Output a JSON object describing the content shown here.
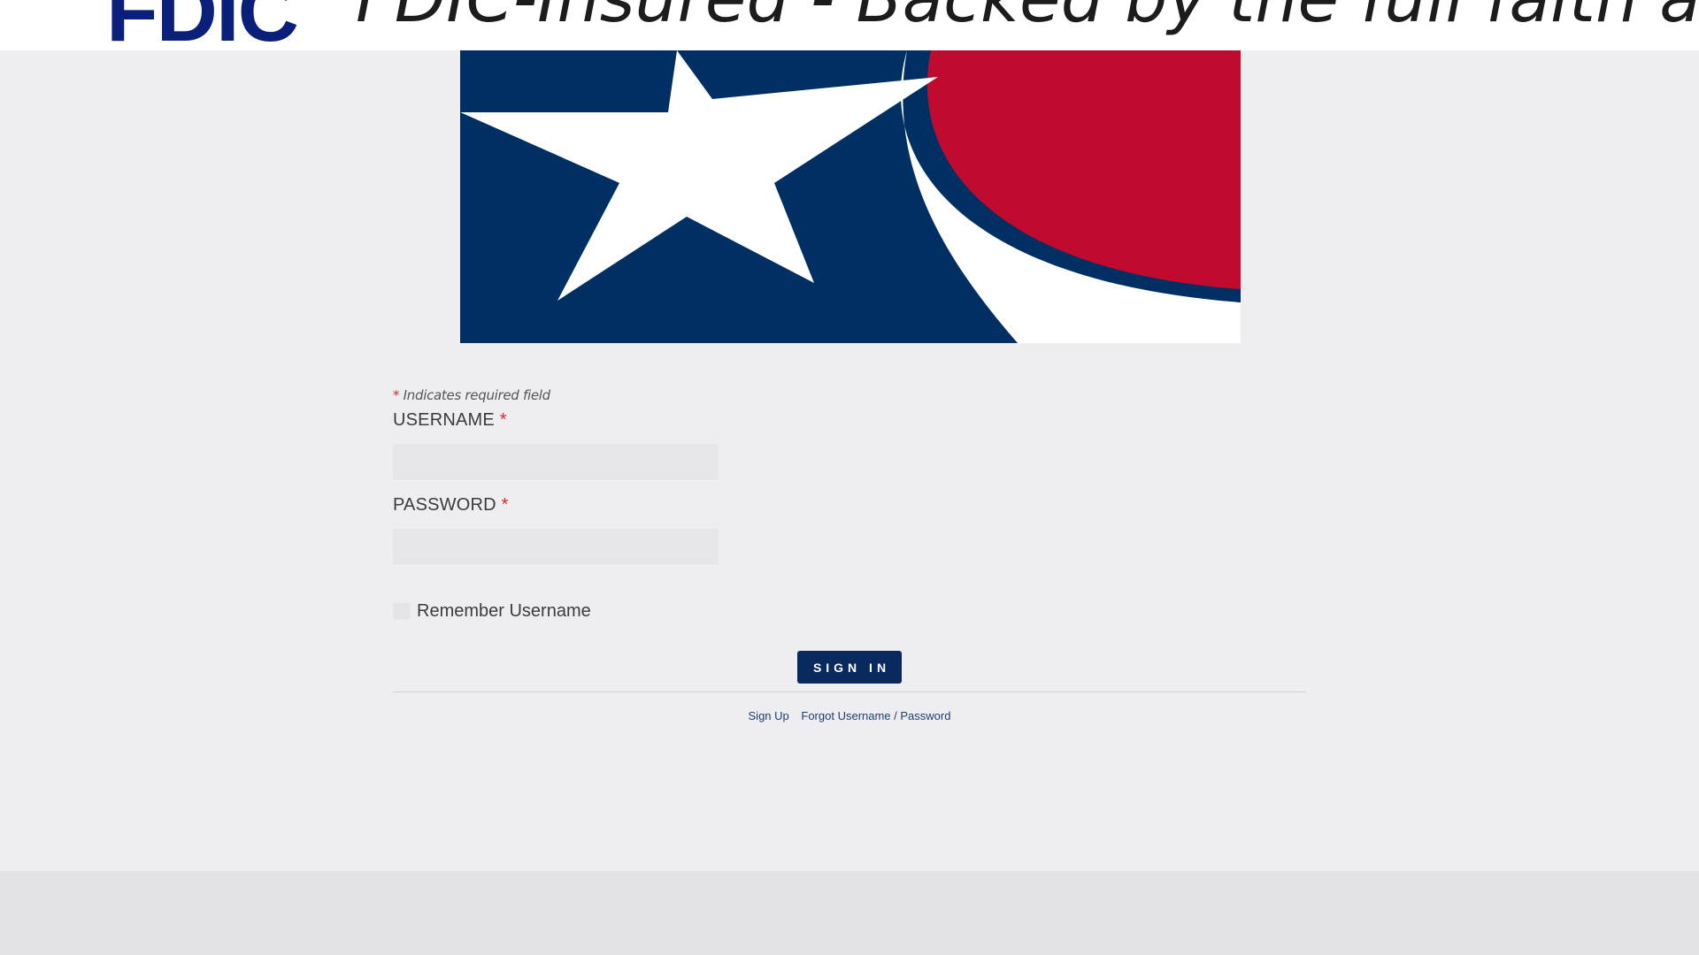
{
  "banner": {
    "logo_text": "FDIC",
    "tagline": "FDIC-Insured - Backed by the full faith and"
  },
  "colors": {
    "navy": "#082a5e",
    "flag_blue": "#003063",
    "flag_red": "#c00a2e",
    "required_red": "#d62b2b",
    "page_bg": "#eeeef0"
  },
  "form": {
    "required_note_star": "*",
    "required_note_text": "Indicates required field",
    "username_label": "USERNAME",
    "username_required": "*",
    "username_value": "",
    "password_label": "PASSWORD",
    "password_required": "*",
    "password_value": "",
    "remember_label": "Remember Username",
    "remember_checked": false,
    "signin_label": "SIGN IN"
  },
  "links": {
    "sign_up": "Sign Up",
    "forgot": "Forgot Username / Password"
  }
}
